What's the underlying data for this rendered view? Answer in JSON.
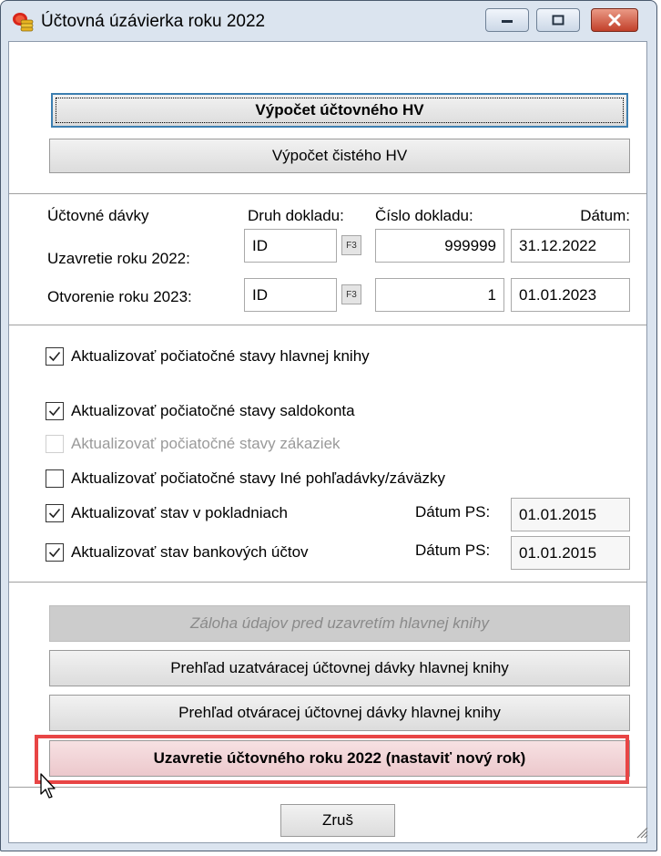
{
  "window": {
    "title": "Účtovná úzávierka roku 2022"
  },
  "buttons": {
    "calc_accounting": "Výpočet účtovného HV",
    "calc_net": "Výpočet čistého HV",
    "backup": "Záloha údajov pred uzavretím hlavnej knihy",
    "closing_overview": "Prehľad uzatváracej účtovnej dávky hlavnej knihy",
    "opening_overview": "Prehľad otváracej účtovnej dávky hlavnej knihy",
    "close_year": "Uzavretie účtovného roku 2022 (nastaviť nový rok)",
    "cancel": "Zruš"
  },
  "batches": {
    "header": {
      "section": "Účtovné dávky",
      "doc_type": "Druh dokladu:",
      "doc_number": "Číslo dokladu:",
      "date": "Dátum:"
    },
    "rows": [
      {
        "label": "Uzavretie roku 2022:",
        "doc_type": "ID",
        "f3": "F3",
        "doc_number": "999999",
        "date": "31.12.2022"
      },
      {
        "label": "Otvorenie roku 2023:",
        "doc_type": "ID",
        "f3": "F3",
        "doc_number": "1",
        "date": "01.01.2023"
      }
    ]
  },
  "options": [
    {
      "label": "Aktualizovať počiatočné stavy hlavnej knihy",
      "checked": true,
      "enabled": true
    },
    {
      "label": "Aktualizovať počiatočné stavy saldokonta",
      "checked": true,
      "enabled": true
    },
    {
      "label": "Aktualizovať počiatočné stavy zákaziek",
      "checked": false,
      "enabled": false
    },
    {
      "label": "Aktualizovať počiatočné stavy Iné pohľadávky/záväzky",
      "checked": false,
      "enabled": true
    },
    {
      "label": "Aktualizovať stav v pokladniach",
      "checked": true,
      "enabled": true,
      "date_label": "Dátum PS:",
      "date": "01.01.2015"
    },
    {
      "label": "Aktualizovať stav bankových účtov",
      "checked": true,
      "enabled": true,
      "date_label": "Dátum PS:",
      "date": "01.01.2015"
    }
  ],
  "icons": {
    "app": "coins-icon",
    "minimize": "minimize-icon",
    "maximize": "maximize-icon",
    "close": "close-icon",
    "cursor": "mouse-pointer-icon",
    "resize": "resize-grip-icon"
  },
  "colors": {
    "highlight_border": "#e84545",
    "close_button": "#c2402a",
    "primary_focus": "#3c7fb1"
  }
}
